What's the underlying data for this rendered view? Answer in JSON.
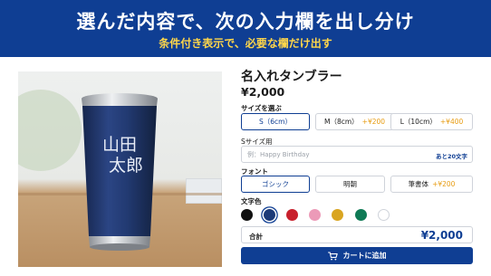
{
  "banner": {
    "title": "選んだ内容で、次の入力欄を出し分け",
    "subtitle": "条件付き表示で、必要な欄だけ出す"
  },
  "product": {
    "name": "名入れタンブラー",
    "price": "¥2,000",
    "engraving": [
      "山田",
      "太郎"
    ],
    "image_icon": "tumbler-photo"
  },
  "size": {
    "label": "サイズを選ぶ",
    "options": [
      {
        "label": "S（6cm）",
        "extra": "",
        "selected": true
      },
      {
        "label": "M（8cm）",
        "extra": "+¥200",
        "selected": false
      },
      {
        "label": "L（10cm）",
        "extra": "+¥400",
        "selected": false
      }
    ]
  },
  "text_field": {
    "label": "Sサイズ用",
    "placeholder": "例：Happy Birthday",
    "value": "",
    "counter": "あと20文字"
  },
  "font": {
    "label": "フォント",
    "options": [
      {
        "label": "ゴシック",
        "extra": "",
        "selected": true
      },
      {
        "label": "明朝",
        "extra": "",
        "selected": false
      },
      {
        "label": "筆書体",
        "extra": "+¥200",
        "selected": false
      }
    ]
  },
  "text_color": {
    "label": "文字色",
    "swatches": [
      {
        "color": "#111111",
        "selected": false
      },
      {
        "color": "#1c3a78",
        "selected": true
      },
      {
        "color": "#c8202c",
        "selected": false
      },
      {
        "color": "#ec9ab8",
        "selected": false
      },
      {
        "color": "#d9a521",
        "selected": false
      },
      {
        "color": "#0f7a55",
        "selected": false
      },
      {
        "color": "#ffffff",
        "selected": false
      }
    ]
  },
  "total": {
    "label": "合計",
    "value": "¥2,000"
  },
  "cart": {
    "label": "カートに追加",
    "icon": "cart-icon"
  },
  "colors": {
    "brand": "#0f3e93",
    "accent": "#ffd64a",
    "extra_price": "#e79c12"
  }
}
